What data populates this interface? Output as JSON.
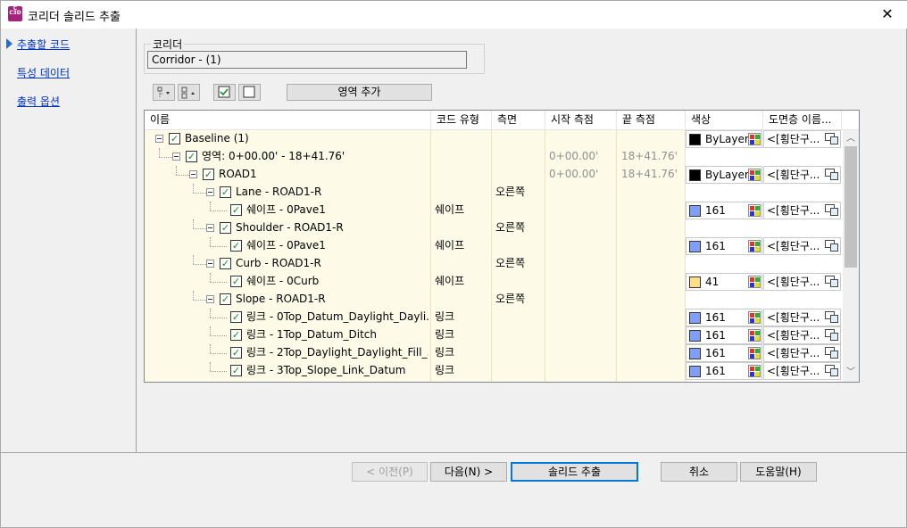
{
  "window": {
    "title": "코리더 솔리드 추출",
    "close_glyph": "✕",
    "app_icon_letter": "C",
    "app_icon_sub": "C3D"
  },
  "nav": {
    "items": [
      "추출할 코드",
      "특성 데이터",
      "출력 옵션"
    ],
    "active_index": 0
  },
  "corridor": {
    "group_label": "코리더",
    "value": "Corridor - (1)"
  },
  "toolbar": {
    "region_add_label": "영역 추가"
  },
  "grid": {
    "headers": [
      "이름",
      "코드 유형",
      "측면",
      "시작 측점",
      "끝 측점",
      "색상",
      "도면층 이름..."
    ],
    "rows": [
      {
        "level": 0,
        "name": "Baseline (1)",
        "code_type": "",
        "side": "",
        "start": "",
        "end": "",
        "color": "ByLayer",
        "swatch": "#000000",
        "layer": "<[횡단구..."
      },
      {
        "level": 1,
        "name": "영역: 0+00.00' - 18+41.76'",
        "code_type": "",
        "side": "",
        "start": "0+00.00'",
        "end": "18+41.76'",
        "color": "",
        "swatch": "",
        "layer": ""
      },
      {
        "level": 2,
        "name": "ROAD1",
        "code_type": "",
        "side": "",
        "start": "0+00.00'",
        "end": "18+41.76'",
        "color": "ByLayer",
        "swatch": "#000000",
        "layer": "<[횡단구..."
      },
      {
        "level": 3,
        "name": "Lane - ROAD1-R",
        "code_type": "",
        "side": "오른쪽",
        "start": "",
        "end": "",
        "color": "",
        "swatch": "",
        "layer": ""
      },
      {
        "level": 4,
        "name": "쉐이프 - 0Pave1",
        "code_type": "쉐이프",
        "side": "",
        "start": "",
        "end": "",
        "color": "161",
        "swatch": "#7f9fff",
        "layer": "<[횡단구..."
      },
      {
        "level": 3,
        "name": "Shoulder - ROAD1-R",
        "code_type": "",
        "side": "오른쪽",
        "start": "",
        "end": "",
        "color": "",
        "swatch": "",
        "layer": ""
      },
      {
        "level": 4,
        "name": "쉐이프 - 0Pave1",
        "code_type": "쉐이프",
        "side": "",
        "start": "",
        "end": "",
        "color": "161",
        "swatch": "#7f9fff",
        "layer": "<[횡단구..."
      },
      {
        "level": 3,
        "name": "Curb - ROAD1-R",
        "code_type": "",
        "side": "오른쪽",
        "start": "",
        "end": "",
        "color": "",
        "swatch": "",
        "layer": ""
      },
      {
        "level": 4,
        "name": "쉐이프 - 0Curb",
        "code_type": "쉐이프",
        "side": "",
        "start": "",
        "end": "",
        "color": "41",
        "swatch": "#ffdf7f",
        "layer": "<[횡단구..."
      },
      {
        "level": 3,
        "name": "Slope - ROAD1-R",
        "code_type": "",
        "side": "오른쪽",
        "start": "",
        "end": "",
        "color": "",
        "swatch": "",
        "layer": ""
      },
      {
        "level": 4,
        "name": "링크 - 0Top_Datum_Daylight_Dayli...",
        "code_type": "링크",
        "side": "",
        "start": "",
        "end": "",
        "color": "161",
        "swatch": "#7f9fff",
        "layer": "<[횡단구..."
      },
      {
        "level": 4,
        "name": "링크 - 1Top_Datum_Ditch",
        "code_type": "링크",
        "side": "",
        "start": "",
        "end": "",
        "color": "161",
        "swatch": "#7f9fff",
        "layer": "<[횡단구..."
      },
      {
        "level": 4,
        "name": "링크 - 2Top_Daylight_Daylight_Fill_...",
        "code_type": "링크",
        "side": "",
        "start": "",
        "end": "",
        "color": "161",
        "swatch": "#7f9fff",
        "layer": "<[횡단구..."
      },
      {
        "level": 4,
        "name": "링크 - 3Top_Slope_Link_Datum",
        "code_type": "링크",
        "side": "",
        "start": "",
        "end": "",
        "color": "161",
        "swatch": "#7f9fff",
        "layer": "<[횡단구..."
      }
    ]
  },
  "buttons": {
    "prev": "< 이전(P)",
    "next": "다음(N) >",
    "extract": "솔리드 추출",
    "cancel": "취소",
    "help": "도움말(H)"
  }
}
